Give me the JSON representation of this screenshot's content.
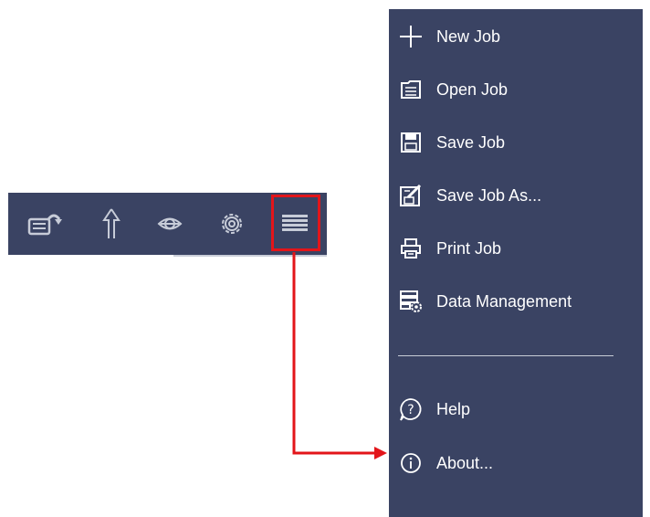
{
  "toolbar": {
    "buttons": [
      {
        "name": "printer-arrow-icon"
      },
      {
        "name": "up-arrow-icon"
      },
      {
        "name": "eye-icon"
      },
      {
        "name": "gear-icon"
      },
      {
        "name": "hamburger-menu-icon"
      }
    ]
  },
  "menu": {
    "items": [
      {
        "label": "New Job",
        "icon": "plus-icon"
      },
      {
        "label": "Open Job",
        "icon": "folder-icon"
      },
      {
        "label": "Save Job",
        "icon": "floppy-disk-icon"
      },
      {
        "label": "Save Job As...",
        "icon": "save-as-icon"
      },
      {
        "label": "Print Job",
        "icon": "printer-icon"
      },
      {
        "label": "Data Management",
        "icon": "data-management-icon"
      },
      {
        "label": "Help",
        "icon": "help-icon"
      },
      {
        "label": "About...",
        "icon": "info-icon"
      }
    ]
  },
  "colors": {
    "panel_bg": "#3a4363",
    "annotation_red": "#e3151a",
    "text": "#ffffff"
  }
}
